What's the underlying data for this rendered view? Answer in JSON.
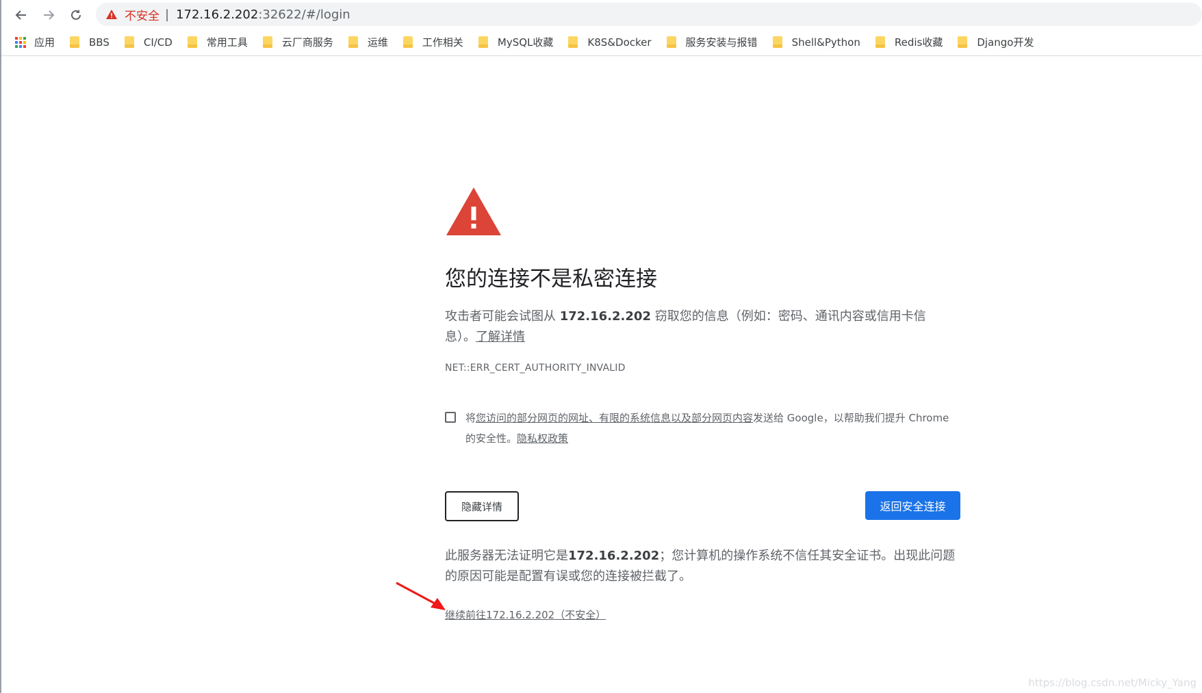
{
  "browser": {
    "insecure_label": "不安全",
    "separator": "|",
    "url_host": "172.16.2.202",
    "url_rest": ":32622/#/login"
  },
  "bookmarks": {
    "apps_label": "应用",
    "items": [
      "BBS",
      "CI/CD",
      "常用工具",
      "云厂商服务",
      "运维",
      "工作相关",
      "MySQL收藏",
      "K8S&Docker",
      "服务安装与报错",
      "Shell&Python",
      "Redis收藏",
      "Django开发"
    ]
  },
  "interstitial": {
    "heading": "您的连接不是私密连接",
    "explain_pre": "攻击者可能会试图从 ",
    "explain_host": "172.16.2.202",
    "explain_post": " 窃取您的信息（例如：密码、通讯内容或信用卡信息）。",
    "learn_more": "了解详情",
    "error_code": "NET::ERR_CERT_AUTHORITY_INVALID",
    "optin_pre": "将",
    "optin_link": "您访问的部分网页的网址、有限的系统信息以及部分网页内容",
    "optin_post": "发送给 Google，以帮助我们提升 Chrome 的安全性。",
    "privacy_link": "隐私权政策",
    "hide_details_button": "隐藏详情",
    "back_to_safety_button": "返回安全连接",
    "details_pre": "此服务器无法证明它是",
    "details_host": "172.16.2.202",
    "details_post": "；您计算机的操作系统不信任其安全证书。出现此问题的原因可能是配置有误或您的连接被拦截了。",
    "proceed_link": "继续前往172.16.2.202（不安全）"
  },
  "watermark": "https://blog.csdn.net/Micky_Yang",
  "colors": {
    "danger": "#d93025",
    "primary": "#1a73e8",
    "folder": "#fcd663",
    "arrow": "#f01818"
  }
}
